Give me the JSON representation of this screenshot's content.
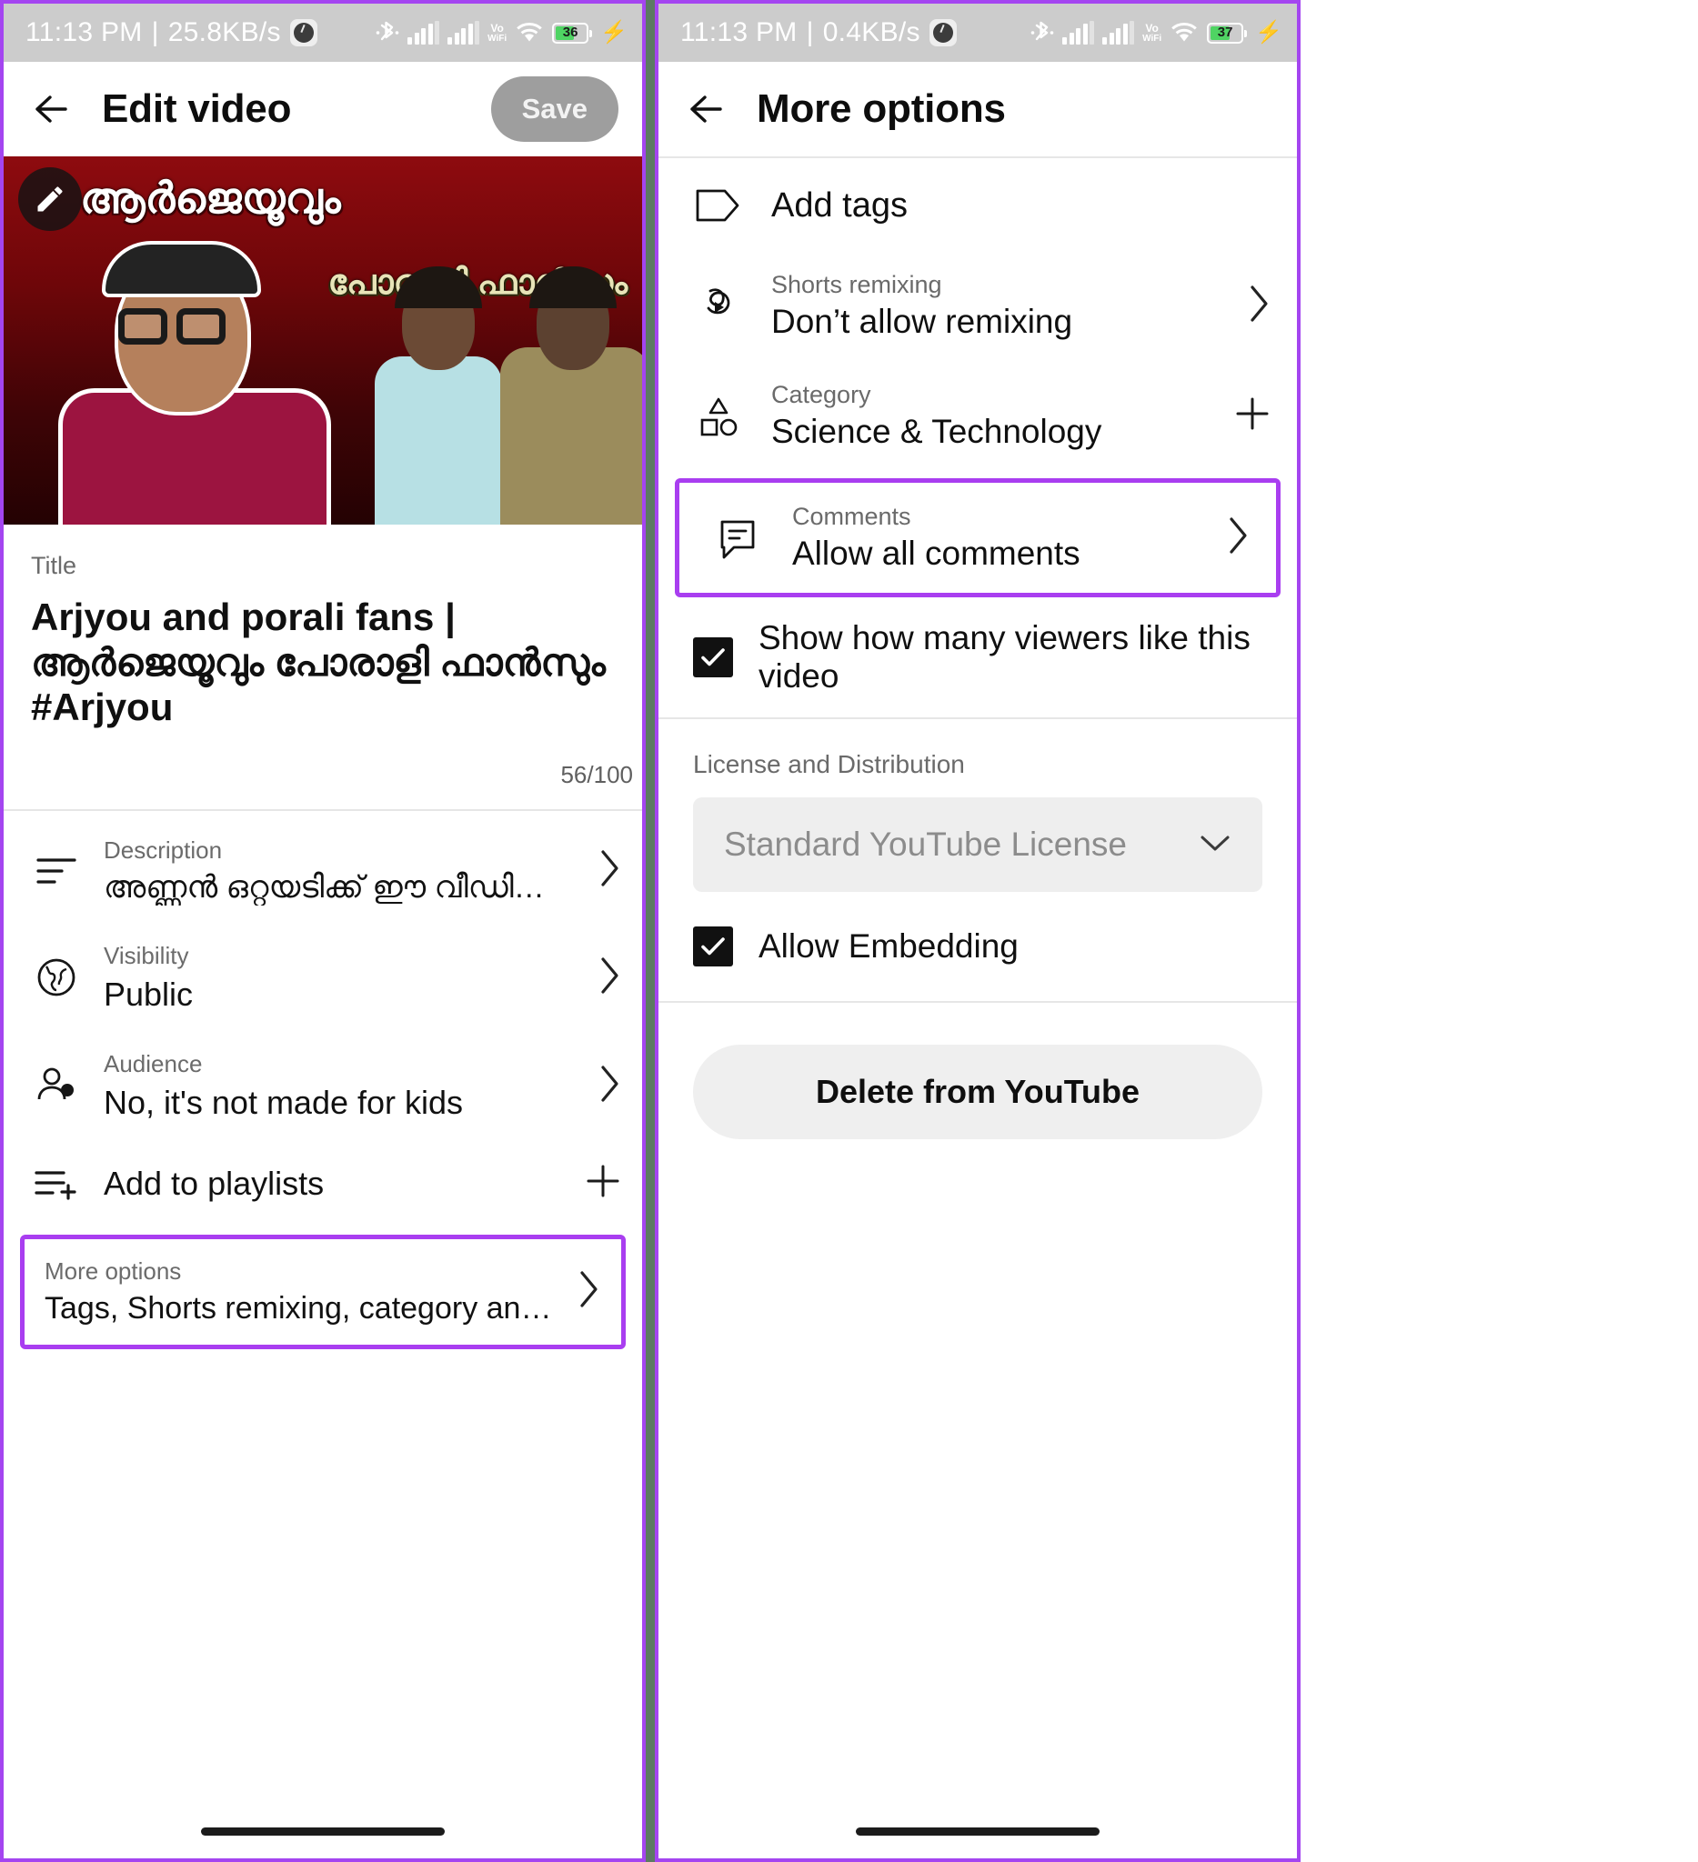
{
  "left": {
    "status_bar": {
      "time": "11:13 PM",
      "separator": "|",
      "net_speed": "25.8KB/s",
      "battery_pct": "36",
      "volte_line1": "Vo",
      "volte_line2": "WiFi"
    },
    "appbar": {
      "title": "Edit video",
      "save_label": "Save"
    },
    "thumbnail": {
      "overlay_title": "ആർജെയൂവും",
      "overlay_sub": "പോരാളി ഫാൻസും"
    },
    "title_field": {
      "label": "Title",
      "value": "Arjyou and porali fans | ആർജെയൂവും പോരാളി ഫാൻസും #Arjyou",
      "counter": "56/100"
    },
    "rows": [
      {
        "sub": "Description",
        "main": "അണ്ണൻ ഒറ്റയടിക്ക് ഈ വീഡിയോ …",
        "icon": "description-icon",
        "trailing": "chevron"
      },
      {
        "sub": "Visibility",
        "main": "Public",
        "icon": "globe-icon",
        "trailing": "chevron"
      },
      {
        "sub": "Audience",
        "main": "No, it's not made for kids",
        "icon": "audience-icon",
        "trailing": "chevron"
      },
      {
        "sub": "",
        "main": "Add to playlists",
        "icon": "playlist-add-icon",
        "trailing": "plus"
      },
      {
        "sub": "More options",
        "main": "Tags, Shorts remixing, category and…",
        "icon": "",
        "trailing": "chevron"
      }
    ]
  },
  "right": {
    "status_bar": {
      "time": "11:13 PM",
      "separator": "|",
      "net_speed": "0.4KB/s",
      "battery_pct": "37",
      "volte_line1": "Vo",
      "volte_line2": "WiFi"
    },
    "appbar": {
      "title": "More options"
    },
    "rows": [
      {
        "sub": "",
        "main": "Add tags",
        "icon": "tag-icon",
        "trailing": "none"
      },
      {
        "sub": "Shorts remixing",
        "main": "Don’t allow remixing",
        "icon": "remix-icon",
        "trailing": "chevron"
      },
      {
        "sub": "Category",
        "main": "Science & Technology",
        "icon": "shapes-icon",
        "trailing": "plus"
      },
      {
        "sub": "Comments",
        "main": "Allow all comments",
        "icon": "comment-icon",
        "trailing": "chevron"
      }
    ],
    "checkbox_viewers": {
      "label": "Show how many viewers like this video",
      "checked": true
    },
    "license_section_label": "License and Distribution",
    "license_select": {
      "value": "Standard YouTube License"
    },
    "checkbox_embedding": {
      "label": "Allow Embedding",
      "checked": true
    },
    "delete_button": {
      "label": "Delete from YouTube"
    }
  },
  "colors": {
    "highlight": "#a93ef0",
    "statusbar_bg": "#cccccc",
    "battery_green": "#4fd463"
  }
}
